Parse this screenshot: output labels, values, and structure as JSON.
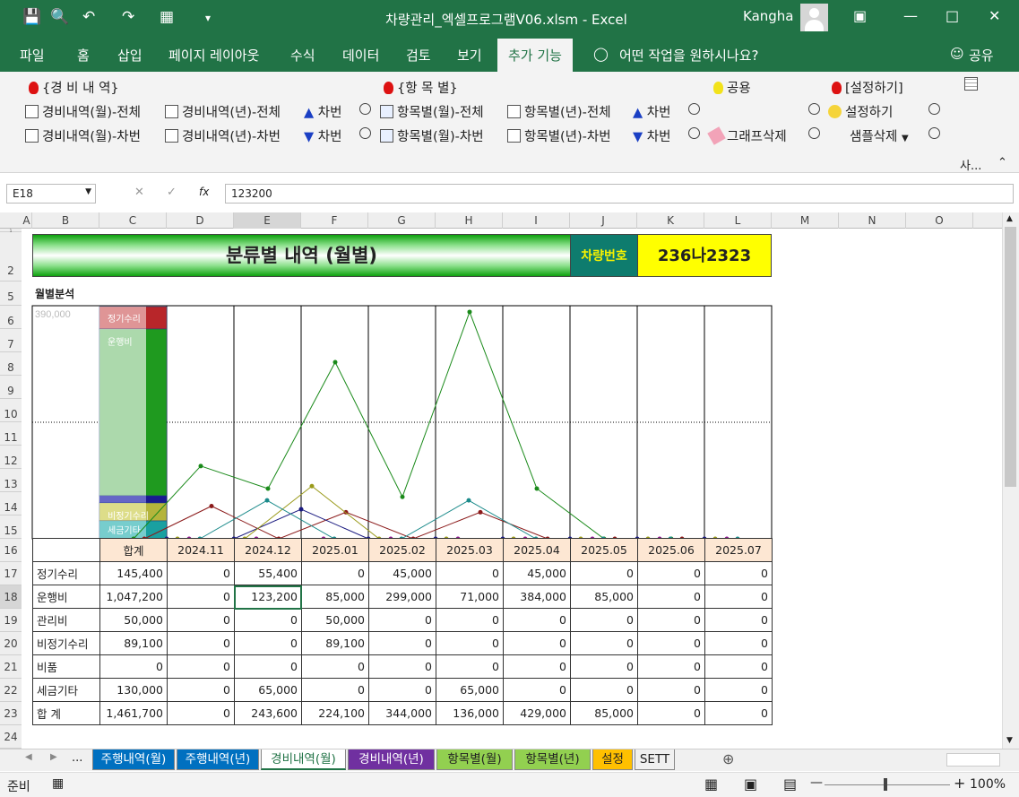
{
  "title_bar": {
    "document": "차량관리_엑셀프로그램V06.xlsm  -  Excel",
    "user": "Kangha"
  },
  "ribbon_tabs": [
    "파일",
    "홈",
    "삽입",
    "페이지 레이아웃",
    "수식",
    "데이터",
    "검토",
    "보기",
    "추가 기능",
    "어떤 작업을 원하시나요?",
    "공유"
  ],
  "ribbon": {
    "group1_title": "{경 비 내 역}",
    "btn1": "경비내역(월)-전체",
    "btn2": "경비내역(년)-전체",
    "btn3": "경비내역(월)-차번",
    "btn4": "경비내역(년)-차번",
    "chabun": "차번",
    "group2_title": "{항 목 별}",
    "btn5": "항목별(월)-전체",
    "btn6": "항목별(년)-전체",
    "btn7": "항목별(월)-차번",
    "btn8": "항목별(년)-차번",
    "group3_title": "공용",
    "delete_chart": "그래프삭제",
    "group4_title": "[설정하기]",
    "settings": "설정하기",
    "sample_delete": "샘플삭제",
    "collapsed": "사..."
  },
  "formula_bar": {
    "cell_ref": "E18",
    "fx": "fx",
    "value": "123200"
  },
  "columns": [
    "A",
    "B",
    "C",
    "D",
    "E",
    "F",
    "G",
    "H",
    "I",
    "J",
    "K",
    "L",
    "M",
    "N",
    "O"
  ],
  "rows": [
    "1",
    "2",
    "5",
    "6",
    "7",
    "8",
    "9",
    "10",
    "11",
    "12",
    "13",
    "14",
    "15",
    "16",
    "17",
    "18",
    "19",
    "20",
    "21",
    "22",
    "23",
    "24"
  ],
  "sheet": {
    "banner": "분류별 내역 (월별)",
    "plate_label": "차량번호",
    "plate_value": "236나2323",
    "subtitle": "월별분석"
  },
  "chart_data": {
    "type": "line",
    "ymax_label": "390,000",
    "ymax": 390000,
    "categories": [
      "2024.11",
      "2024.12",
      "2025.01",
      "2025.02",
      "2025.03",
      "2025.04",
      "2025.05",
      "2025.06",
      "2025.07"
    ],
    "series": [
      {
        "name": "정기수리",
        "color": "#8b1a1a",
        "values": [
          0,
          55400,
          0,
          45000,
          0,
          45000,
          0,
          0,
          0
        ]
      },
      {
        "name": "운행비",
        "color": "#1a8a1a",
        "values": [
          0,
          123200,
          85000,
          299000,
          71000,
          384000,
          85000,
          0,
          0
        ]
      },
      {
        "name": "관리비",
        "color": "#1a1a80",
        "values": [
          0,
          0,
          50000,
          0,
          0,
          0,
          0,
          0,
          0
        ]
      },
      {
        "name": "비정기수리",
        "color": "#9a9a1a",
        "values": [
          0,
          0,
          89100,
          0,
          0,
          0,
          0,
          0,
          0
        ]
      },
      {
        "name": "비품",
        "color": "#8a1a8a",
        "values": [
          0,
          0,
          0,
          0,
          0,
          0,
          0,
          0,
          0
        ]
      },
      {
        "name": "세금기타",
        "color": "#1a8a8a",
        "values": [
          0,
          65000,
          0,
          0,
          65000,
          0,
          0,
          0,
          0
        ]
      }
    ],
    "stack_labels": [
      "정기수리",
      "운행비",
      "비정기수리",
      "세금기타"
    ]
  },
  "table": {
    "header": [
      "합계",
      "2024.11",
      "2024.12",
      "2025.01",
      "2025.02",
      "2025.03",
      "2025.04",
      "2025.05",
      "2025.06",
      "2025.07"
    ],
    "rows": [
      {
        "label": "정기수리",
        "cells": [
          "145,400",
          "0",
          "55,400",
          "0",
          "45,000",
          "0",
          "45,000",
          "0",
          "0",
          "0"
        ]
      },
      {
        "label": "운행비",
        "cells": [
          "1,047,200",
          "0",
          "123,200",
          "85,000",
          "299,000",
          "71,000",
          "384,000",
          "85,000",
          "0",
          "0"
        ]
      },
      {
        "label": "관리비",
        "cells": [
          "50,000",
          "0",
          "0",
          "50,000",
          "0",
          "0",
          "0",
          "0",
          "0",
          "0"
        ]
      },
      {
        "label": "비정기수리",
        "cells": [
          "89,100",
          "0",
          "0",
          "89,100",
          "0",
          "0",
          "0",
          "0",
          "0",
          "0"
        ]
      },
      {
        "label": "비품",
        "cells": [
          "0",
          "0",
          "0",
          "0",
          "0",
          "0",
          "0",
          "0",
          "0",
          "0"
        ]
      },
      {
        "label": "세금기타",
        "cells": [
          "130,000",
          "0",
          "65,000",
          "0",
          "0",
          "65,000",
          "0",
          "0",
          "0",
          "0"
        ]
      },
      {
        "label": "합 계",
        "cells": [
          "1,461,700",
          "0",
          "243,600",
          "224,100",
          "344,000",
          "136,000",
          "429,000",
          "85,000",
          "0",
          "0"
        ]
      }
    ]
  },
  "sheet_tabs": {
    "ellipsis": "...",
    "items": [
      {
        "label": "주행내역(월)",
        "color": "#0070c0",
        "text": "#ffffff"
      },
      {
        "label": "주행내역(년)",
        "color": "#0070c0",
        "text": "#ffffff"
      },
      {
        "label": "경비내역(월)",
        "color": "#ffffff",
        "text": "#217346"
      },
      {
        "label": "경비내역(년)",
        "color": "#7030a0",
        "text": "#ffffff"
      },
      {
        "label": "항목별(월)",
        "color": "#92d050",
        "text": "#222222"
      },
      {
        "label": "항목별(년)",
        "color": "#92d050",
        "text": "#222222"
      },
      {
        "label": "설정",
        "color": "#ffc000",
        "text": "#222222"
      },
      {
        "label": "SETT",
        "color": "#f0f0f0",
        "text": "#222222"
      }
    ]
  },
  "status": {
    "ready": "준비",
    "zoom": "100%"
  },
  "colors": {
    "excel_green": "#217346",
    "banner_green": "#0ea10e",
    "plate_teal": "#0e7c6e",
    "plate_yellow": "#ffff00"
  }
}
